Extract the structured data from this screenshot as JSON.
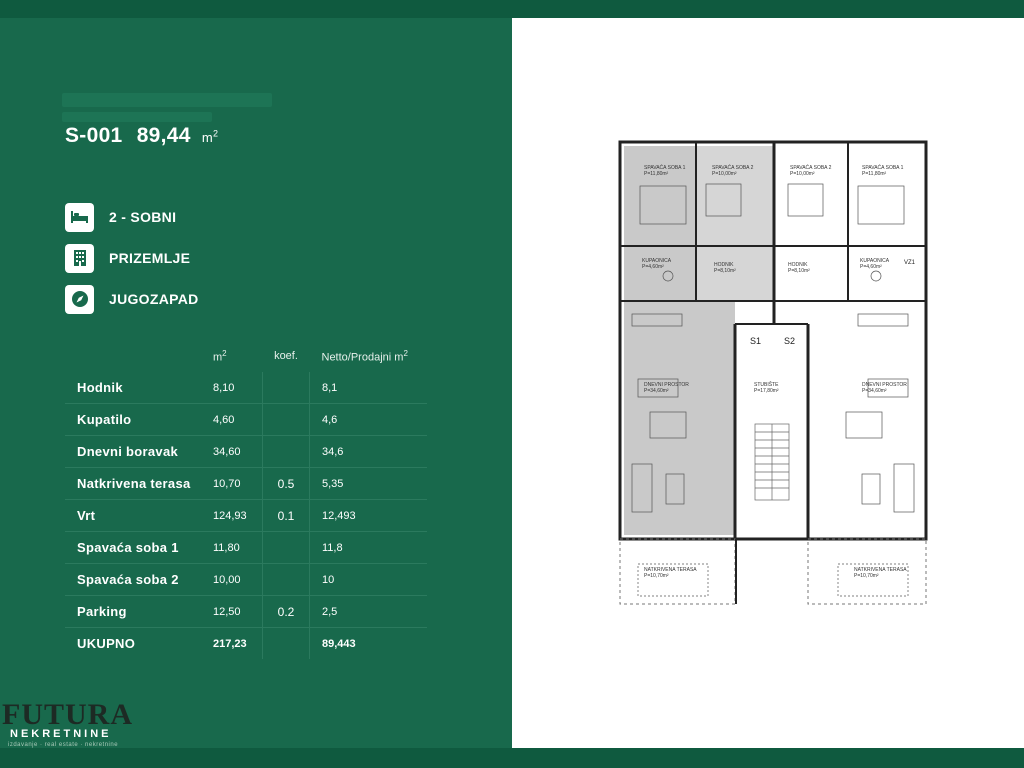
{
  "unit": {
    "code": "S-001",
    "area": "89,44",
    "area_unit": "m",
    "area_unit_exp": "2"
  },
  "features": [
    {
      "label": "2 - SOBNI",
      "icon": "bed-icon"
    },
    {
      "label": "PRIZEMLJE",
      "icon": "building-icon"
    },
    {
      "label": "JUGOZAPAD",
      "icon": "compass-icon"
    }
  ],
  "table": {
    "headers": {
      "m2": "m",
      "m2_exp": "2",
      "koef": "koef.",
      "net": "Netto/Prodajni m",
      "net_exp": "2"
    },
    "rows": [
      {
        "name": "Hodnik",
        "m2": "8,10",
        "koef": "",
        "net": "8,1"
      },
      {
        "name": "Kupatilo",
        "m2": "4,60",
        "koef": "",
        "net": "4,6"
      },
      {
        "name": "Dnevni boravak",
        "m2": "34,60",
        "koef": "",
        "net": "34,6"
      },
      {
        "name": "Natkrivena terasa",
        "m2": "10,70",
        "koef": "0.5",
        "net": "5,35"
      },
      {
        "name": "Vrt",
        "m2": "124,93",
        "koef": "0.1",
        "net": "12,493"
      },
      {
        "name": "Spavaća soba 1",
        "m2": "11,80",
        "koef": "",
        "net": "11,8"
      },
      {
        "name": "Spavaća soba 2",
        "m2": "10,00",
        "koef": "",
        "net": "10"
      },
      {
        "name": "Parking",
        "m2": "12,50",
        "koef": "0.2",
        "net": "2,5"
      }
    ],
    "total": {
      "name": "UKUPNO",
      "m2": "217,23",
      "koef": "",
      "net": "89,443"
    }
  },
  "logo": {
    "brand": "FUTURA",
    "sub": "NEKRETNINE",
    "tag": "izdavanje · real estate · nekretnine"
  },
  "plan": {
    "rooms": {
      "spavaca_soba_1_l": "SPAVAĆA SOBA 1",
      "spavaca_soba_1_l_area": "P=11,80m²",
      "spavaca_soba_2_l": "SPAVAĆA SOBA 2",
      "spavaca_soba_2_l_area": "P=10,00m²",
      "spavaca_soba_2_r": "SPAVAĆA SOBA 2",
      "spavaca_soba_2_r_area": "P=10,00m²",
      "spavaca_soba_1_r": "SPAVAĆA SOBA 1",
      "spavaca_soba_1_r_area": "P=11,80m²",
      "kupaonica_l": "KUPAONICA",
      "kupaonica_l_area": "P=4,60m²",
      "kupaonica_r": "KUPAONICA",
      "kupaonica_r_area": "P=4,60m²",
      "hodnik_l": "HODNIK",
      "hodnik_l_area": "P=8,10m²",
      "hodnik_r": "HODNIK",
      "hodnik_r_area": "P=8,10m²",
      "dnevni_l": "DNEVNI PROSTOR",
      "dnevni_l_area": "P=34,60m²",
      "dnevni_r": "DNEVNI PROSTOR",
      "dnevni_r_area": "P=34,60m²",
      "stubiste": "STUBIŠTE",
      "stubiste_area": "P=17,80m²",
      "terasa_l": "NATKRIVENA TERASA",
      "terasa_l_area": "P=10,70m²",
      "terasa_r": "NATKRIVENA TERASA",
      "terasa_r_area": "P=10,70m²",
      "floor": "ker.pl."
    },
    "labels": {
      "s1": "S1",
      "s2": "S2",
      "vz1": "VZ1"
    }
  }
}
